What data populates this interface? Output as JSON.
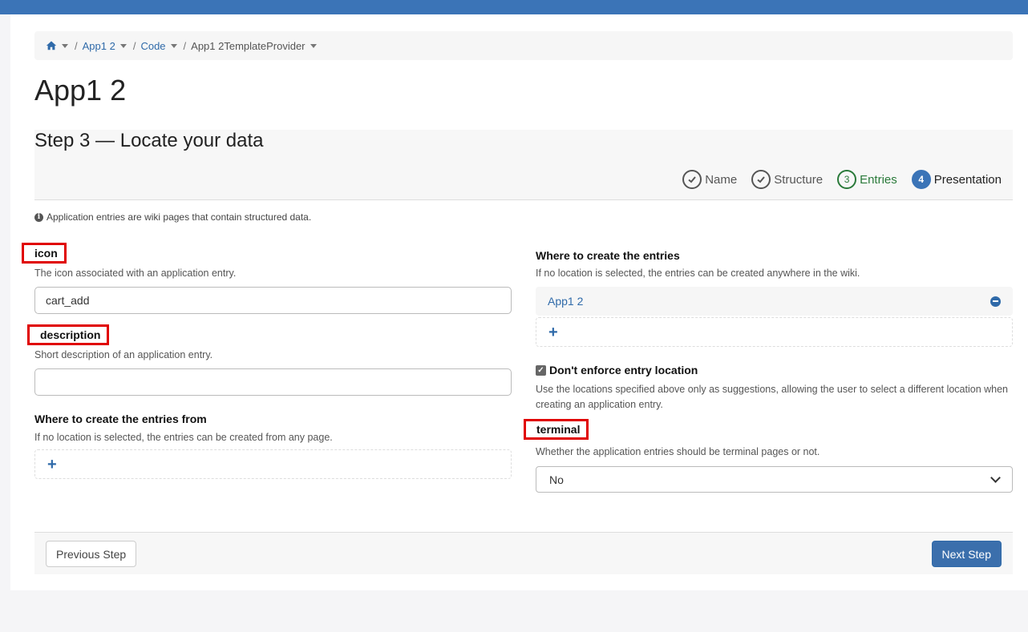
{
  "breadcrumb": {
    "items": [
      "App1 2",
      "Code",
      "App1 2TemplateProvider"
    ]
  },
  "page": {
    "title": "App1 2"
  },
  "step": {
    "title": "Step 3 — Locate your data",
    "steps": [
      {
        "number": "1",
        "label": "Name",
        "state": "done"
      },
      {
        "number": "2",
        "label": "Structure",
        "state": "done"
      },
      {
        "number": "3",
        "label": "Entries",
        "state": "active"
      },
      {
        "number": "4",
        "label": "Presentation",
        "state": "next"
      }
    ]
  },
  "info": {
    "text": "Application entries are wiki pages that contain structured data."
  },
  "fields": {
    "icon": {
      "label": "icon",
      "hint": "The icon associated with an application entry.",
      "value": "cart_add"
    },
    "description": {
      "label": "description",
      "hint": "Short description of an application entry.",
      "value": ""
    },
    "entries_from": {
      "label": "Where to create the entries from",
      "hint": "If no location is selected, the entries can be created from any page."
    },
    "entries_where": {
      "label": "Where to create the entries",
      "hint": "If no location is selected, the entries can be created anywhere in the wiki.",
      "locations": [
        "App1 2"
      ]
    },
    "enforce": {
      "label": "Don't enforce entry location",
      "checked": true,
      "hint": "Use the locations specified above only as suggestions, allowing the user to select a different location when creating an application entry."
    },
    "terminal": {
      "label": "terminal",
      "hint": "Whether the application entries should be terminal pages or not.",
      "value": "No"
    }
  },
  "footer": {
    "previous": "Previous Step",
    "next": "Next Step"
  },
  "colors": {
    "accent": "#3b74b7",
    "highlight": "#e00000",
    "active_step": "#2a7a3a"
  }
}
